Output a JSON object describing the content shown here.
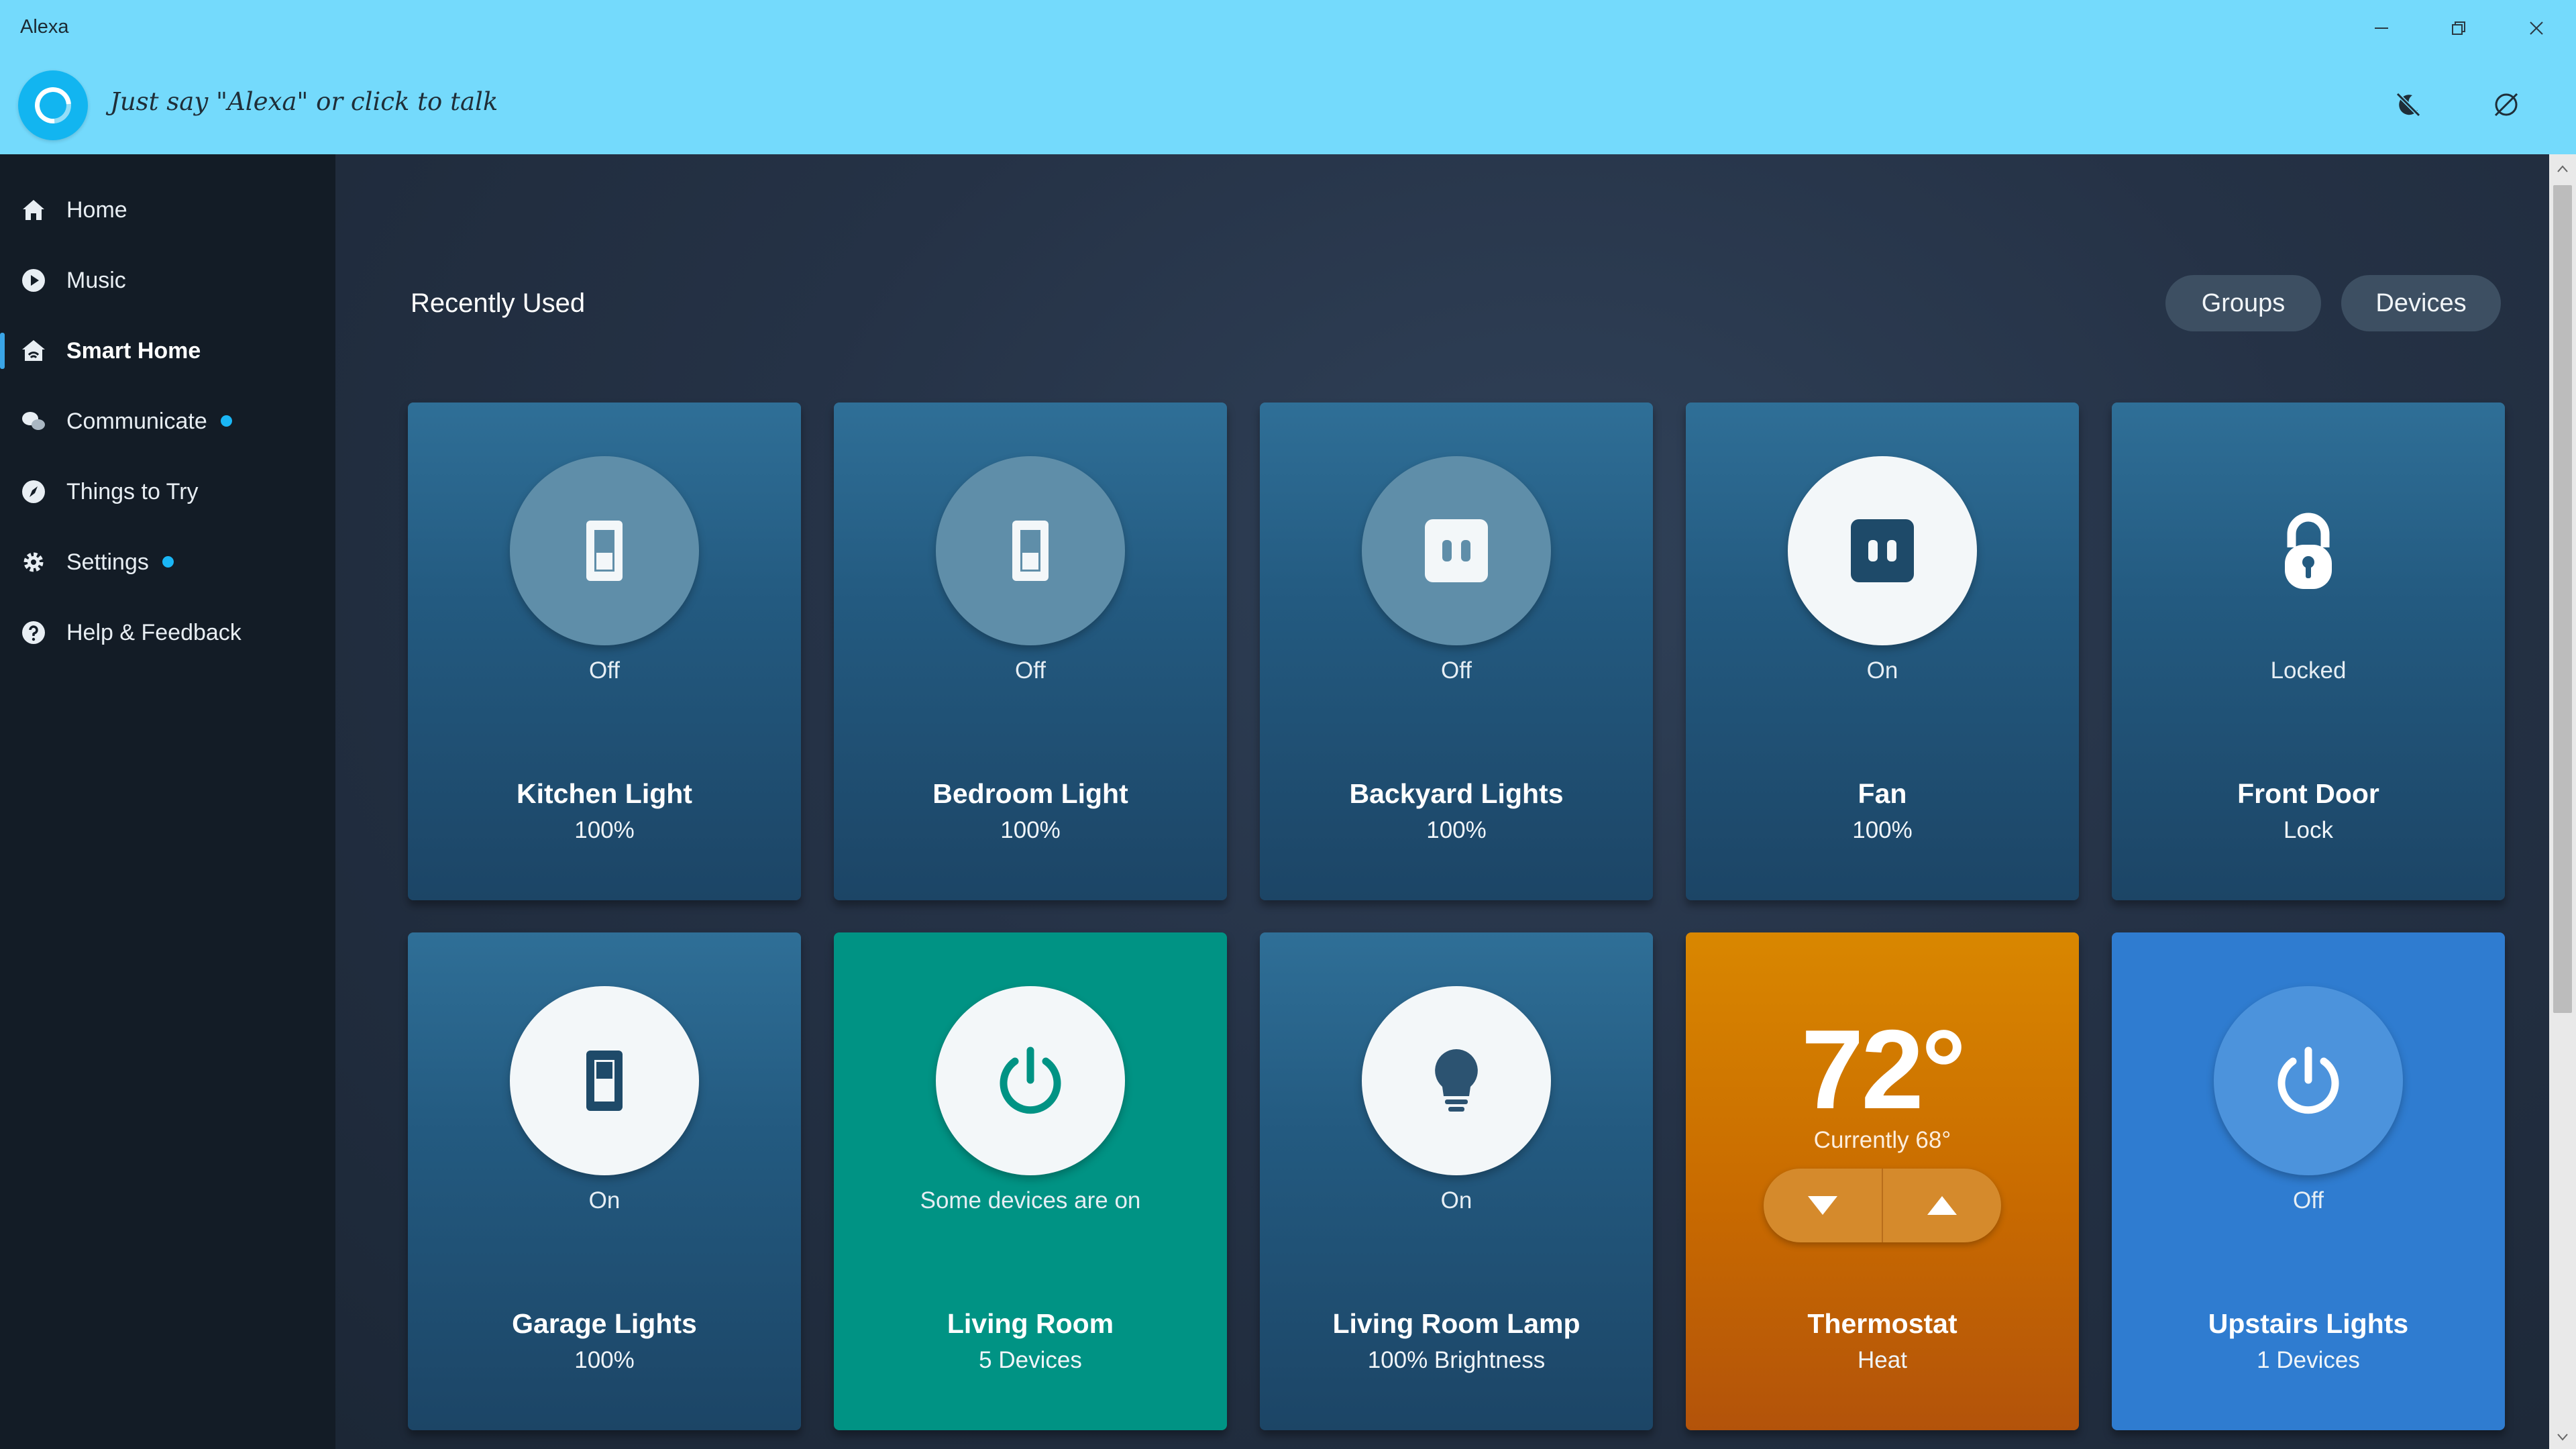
{
  "window": {
    "title": "Alexa"
  },
  "header": {
    "prompt": "Just say \"Alexa\" or click to talk"
  },
  "sidebar": {
    "items": [
      {
        "label": "Home",
        "icon": "home-icon",
        "active": false,
        "dot": false
      },
      {
        "label": "Music",
        "icon": "play-icon",
        "active": false,
        "dot": false
      },
      {
        "label": "Smart Home",
        "icon": "smart-home-icon",
        "active": true,
        "dot": false
      },
      {
        "label": "Communicate",
        "icon": "chat-icon",
        "active": false,
        "dot": true
      },
      {
        "label": "Things to Try",
        "icon": "compass-icon",
        "active": false,
        "dot": false
      },
      {
        "label": "Settings",
        "icon": "gear-icon",
        "active": false,
        "dot": true
      },
      {
        "label": "Help & Feedback",
        "icon": "help-icon",
        "active": false,
        "dot": false
      }
    ]
  },
  "main": {
    "section_title": "Recently Used",
    "filters": {
      "groups": "Groups",
      "devices": "Devices"
    },
    "tiles": [
      {
        "name": "Kitchen Light",
        "sub": "100%",
        "status": "Off",
        "icon": "light-switch-icon"
      },
      {
        "name": "Bedroom Light",
        "sub": "100%",
        "status": "Off",
        "icon": "light-switch-icon"
      },
      {
        "name": "Backyard Lights",
        "sub": "100%",
        "status": "Off",
        "icon": "plug-icon"
      },
      {
        "name": "Fan",
        "sub": "100%",
        "status": "On",
        "icon": "plug-icon"
      },
      {
        "name": "Front Door",
        "sub": "Lock",
        "status": "Locked",
        "icon": "lock-icon"
      },
      {
        "name": "Garage Lights",
        "sub": "100%",
        "status": "On",
        "icon": "light-switch-icon"
      },
      {
        "name": "Living Room",
        "sub": "5 Devices",
        "status": "Some devices are on",
        "icon": "power-icon"
      },
      {
        "name": "Living Room Lamp",
        "sub": "100% Brightness",
        "status": "On",
        "icon": "bulb-icon"
      },
      {
        "name": "Thermostat",
        "sub": "Heat",
        "temperature": "72°",
        "current": "Currently 68°",
        "icon": "thermostat"
      },
      {
        "name": "Upstairs Lights",
        "sub": "1 Devices",
        "status": "Off",
        "icon": "power-icon"
      }
    ]
  },
  "colors": {
    "header_bg": "#74dafc",
    "sidebar_bg": "#131c26",
    "accent": "#1ab6f5",
    "tile_blue": "#235a80",
    "tile_teal": "#009384",
    "tile_orange": "#c86a00",
    "tile_royal": "#2f7cd0"
  }
}
